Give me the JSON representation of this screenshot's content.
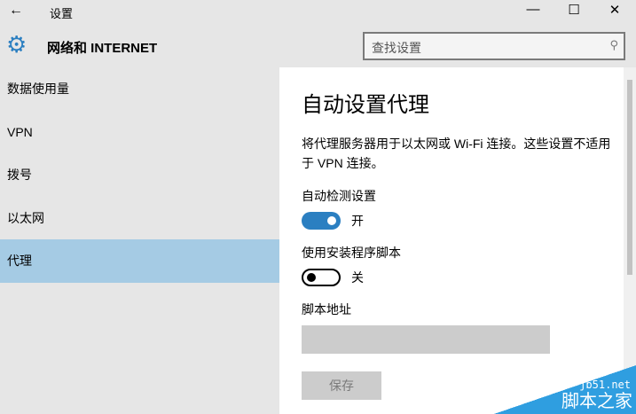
{
  "window": {
    "title": "设置",
    "back": "←",
    "minimize": "—",
    "maximize": "☐",
    "close": "✕"
  },
  "header": {
    "title": "网络和 INTERNET",
    "search_placeholder": "查找设置"
  },
  "sidebar": {
    "items": [
      {
        "label": "数据使用量"
      },
      {
        "label": "VPN"
      },
      {
        "label": "拨号"
      },
      {
        "label": "以太网"
      },
      {
        "label": "代理"
      }
    ]
  },
  "main": {
    "title": "自动设置代理",
    "description": "将代理服务器用于以太网或 Wi-Fi 连接。这些设置不适用于 VPN 连接。",
    "auto_detect": {
      "label": "自动检测设置",
      "state": "开"
    },
    "script": {
      "label": "使用安装程序脚本",
      "state": "关"
    },
    "address_label": "脚本地址",
    "save_label": "保存"
  },
  "watermark": {
    "url": "jb51.net",
    "name": "脚本之家"
  }
}
